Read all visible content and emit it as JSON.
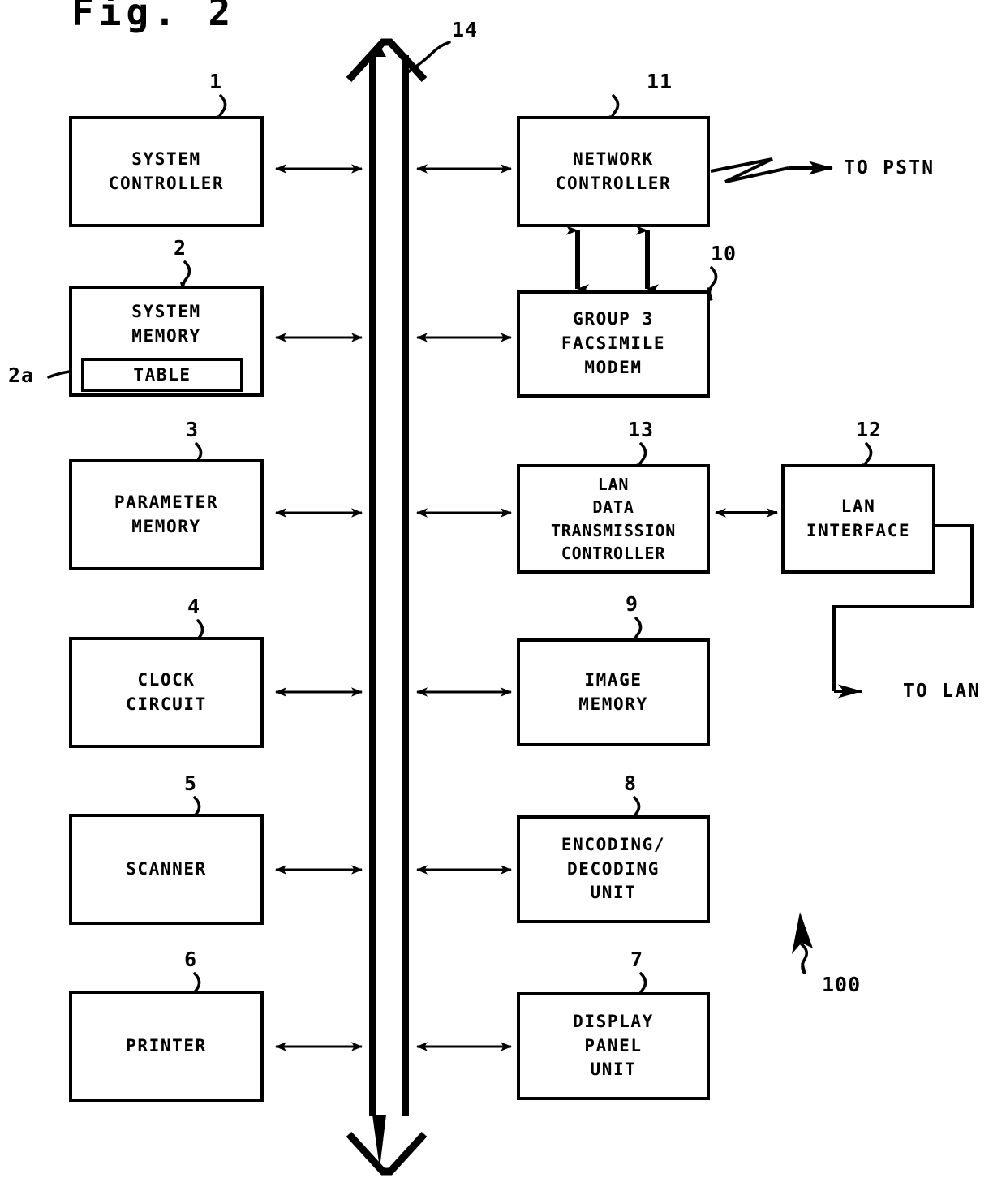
{
  "figure": {
    "title": "Fig. 2",
    "system_ref": "100"
  },
  "blocks": [
    {
      "id": "system-controller",
      "ref": "1",
      "lines": [
        "SYSTEM",
        "CONTROLLER"
      ]
    },
    {
      "id": "system-memory",
      "ref": "2",
      "lines": [
        "SYSTEM",
        "MEMORY"
      ],
      "child": {
        "id": "table",
        "ref": "2a",
        "lines": [
          "TABLE"
        ]
      }
    },
    {
      "id": "parameter-memory",
      "ref": "3",
      "lines": [
        "PARAMETER",
        "MEMORY"
      ]
    },
    {
      "id": "clock-circuit",
      "ref": "4",
      "lines": [
        "CLOCK",
        "CIRCUIT"
      ]
    },
    {
      "id": "scanner",
      "ref": "5",
      "lines": [
        "SCANNER"
      ]
    },
    {
      "id": "printer",
      "ref": "6",
      "lines": [
        "PRINTER"
      ]
    },
    {
      "id": "network-controller",
      "ref": "11",
      "lines": [
        "NETWORK",
        "CONTROLLER"
      ]
    },
    {
      "id": "group-3-facsimile-modem",
      "ref": "10",
      "lines": [
        "GROUP 3",
        "FACSIMILE",
        "MODEM"
      ]
    },
    {
      "id": "lan-data-transmission-controller",
      "ref": "13",
      "lines": [
        "LAN",
        "DATA",
        "TRANSMISSION",
        "CONTROLLER"
      ]
    },
    {
      "id": "lan-interface",
      "ref": "12",
      "lines": [
        "LAN",
        "INTERFACE"
      ]
    },
    {
      "id": "image-memory",
      "ref": "9",
      "lines": [
        "IMAGE",
        "MEMORY"
      ]
    },
    {
      "id": "encoding-decoding-unit",
      "ref": "8",
      "lines": [
        "ENCODING/",
        "DECODING",
        "UNIT"
      ]
    },
    {
      "id": "display-panel-unit",
      "ref": "7",
      "lines": [
        "DISPLAY",
        "PANEL",
        "UNIT"
      ]
    }
  ],
  "bus": {
    "id": "system-bus",
    "ref": "14"
  },
  "external": {
    "pstn_label": "TO PSTN",
    "lan_label": "TO LAN"
  },
  "refs": {
    "r1": "1",
    "r2": "2",
    "r2a": "2a",
    "r3": "3",
    "r4": "4",
    "r5": "5",
    "r6": "6",
    "r7": "7",
    "r8": "8",
    "r9": "9",
    "r10": "10",
    "r11": "11",
    "r12": "12",
    "r13": "13",
    "r14": "14",
    "r100": "100"
  },
  "labels": {
    "system_controller_l1": "SYSTEM",
    "system_controller_l2": "CONTROLLER",
    "system_memory_l1": "SYSTEM",
    "system_memory_l2": "MEMORY",
    "table_l1": "TABLE",
    "parameter_memory_l1": "PARAMETER",
    "parameter_memory_l2": "MEMORY",
    "clock_circuit_l1": "CLOCK",
    "clock_circuit_l2": "CIRCUIT",
    "scanner_l1": "SCANNER",
    "printer_l1": "PRINTER",
    "network_controller_l1": "NETWORK",
    "network_controller_l2": "CONTROLLER",
    "modem_l1": "GROUP 3",
    "modem_l2": "FACSIMILE",
    "modem_l3": "MODEM",
    "lan_dtc_l1": "LAN",
    "lan_dtc_l2": "DATA",
    "lan_dtc_l3": "TRANSMISSION",
    "lan_dtc_l4": "CONTROLLER",
    "lan_if_l1": "LAN",
    "lan_if_l2": "INTERFACE",
    "image_memory_l1": "IMAGE",
    "image_memory_l2": "MEMORY",
    "encdec_l1": "ENCODING/",
    "encdec_l2": "DECODING",
    "encdec_l3": "UNIT",
    "display_l1": "DISPLAY",
    "display_l2": "PANEL",
    "display_l3": "UNIT"
  }
}
